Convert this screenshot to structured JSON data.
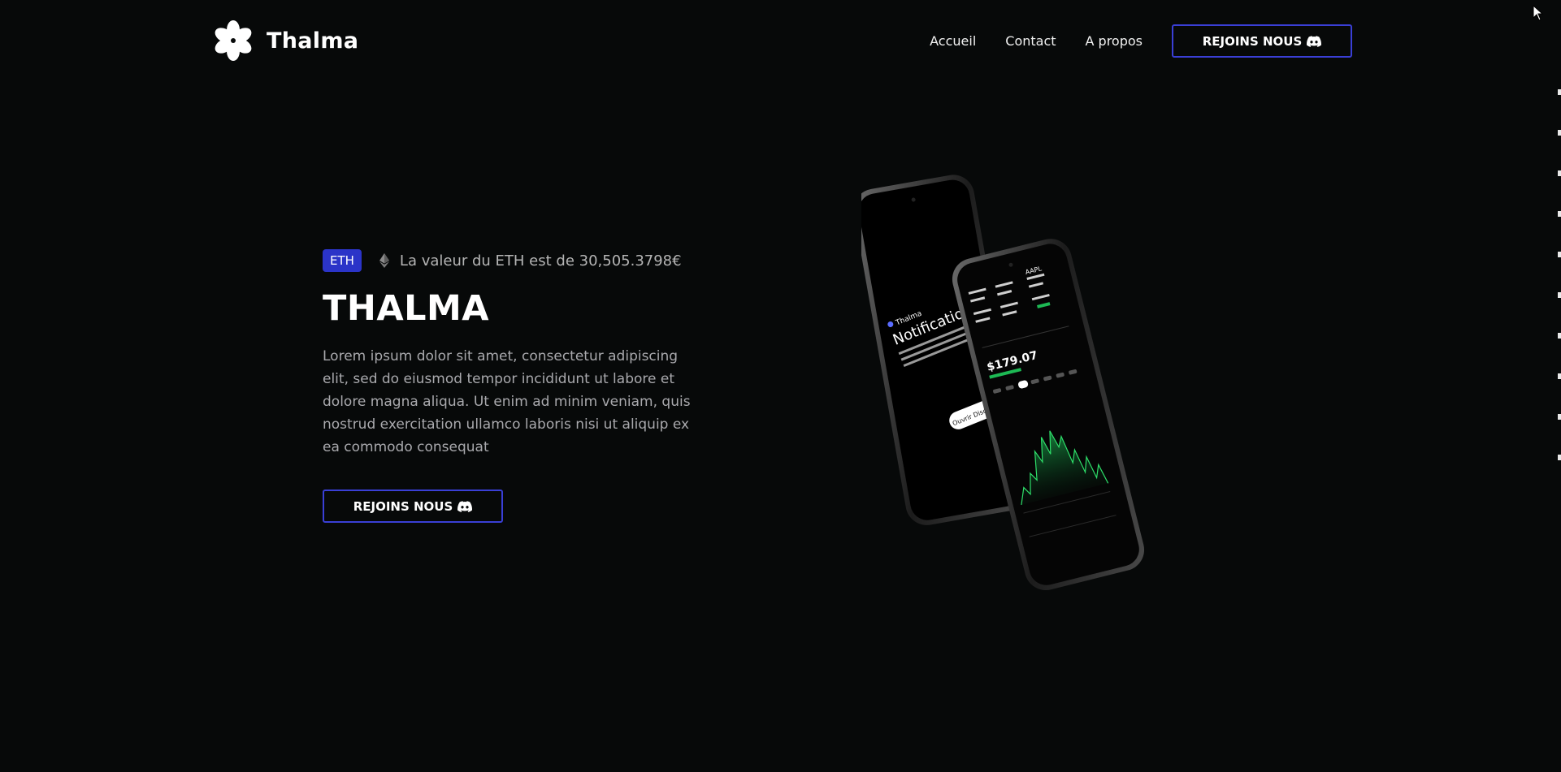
{
  "brand": {
    "name": "Thalma",
    "logo_icon": "flower-icon"
  },
  "nav": {
    "links": [
      "Accueil",
      "Contact",
      "A propos"
    ],
    "cta_label": "REJOINS NOUS"
  },
  "ticker": {
    "badge": "ETH",
    "icon": "ethereum-icon",
    "text": "La valeur du ETH est de 30,505.3798€"
  },
  "hero": {
    "title": "THALMA",
    "description": "Lorem ipsum dolor sit amet, consectetur adipiscing elit, sed do eiusmod tempor incididunt ut labore et dolore magna aliqua. Ut enim ad minim veniam, quis nostrud exercitation ullamco laboris nisi ut aliquip ex ea commodo consequat",
    "cta_label": "REJOINS NOUS"
  },
  "phones": {
    "notification_brand": "Thalma",
    "notification_title": "Notification",
    "notification_button": "Ouvrir Discord",
    "stock_symbol": "AAPL",
    "stock_price": "$179.07"
  },
  "colors": {
    "background": "#070909",
    "accent": "#2b34c8",
    "button_border": "#3a3fd6",
    "text_muted": "#a9a9ad"
  }
}
